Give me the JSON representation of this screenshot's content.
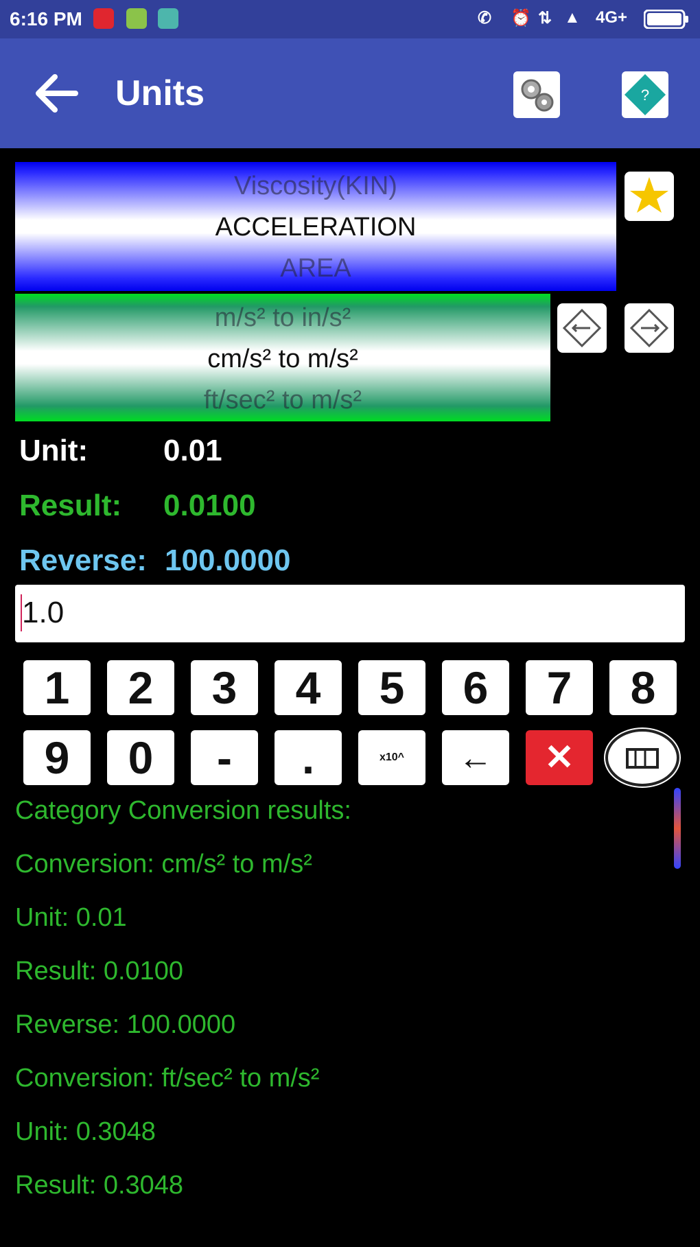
{
  "status_bar": {
    "time": "6:16 PM",
    "network": "4G+"
  },
  "toolbar": {
    "title": "Units",
    "back_icon": "arrow-left-icon",
    "settings_icon": "gears-icon",
    "help_icon": "help-diamond-icon"
  },
  "category_picker": {
    "above": "Viscosity(KIN)",
    "selected": "ACCELERATION",
    "below": "AREA"
  },
  "conversion_picker": {
    "above": "m/s² to in/s²",
    "selected": "cm/s² to  m/s²",
    "below": "ft/sec² to m/s²"
  },
  "values": {
    "unit_label": "Unit:",
    "unit_value": "0.01",
    "result_label": "Result:",
    "result_value": "0.0100",
    "reverse_label": "Reverse:",
    "reverse_value": "100.0000"
  },
  "input": {
    "value": "1.0"
  },
  "keypad": {
    "row1": [
      "1",
      "2",
      "3",
      "4",
      "5",
      "6",
      "7",
      "8"
    ],
    "row2": [
      "9",
      "0",
      "-",
      ".",
      "x10^",
      "←",
      "✕",
      "calc"
    ]
  },
  "results": [
    "Category Conversion results:",
    "Conversion: cm/s² to  m/s²",
    "Unit: 0.01",
    "Result: 0.0100",
    "Reverse: 100.0000",
    "Conversion: ft/sec² to m/s²",
    "Unit: 0.3048",
    "Result: 0.3048"
  ],
  "colors": {
    "toolbar": "#3f51b5",
    "status_bar": "#32409a",
    "result_green": "#2eb82e",
    "reverse_blue": "#6ec6f0",
    "delete_red": "#e4262f"
  }
}
